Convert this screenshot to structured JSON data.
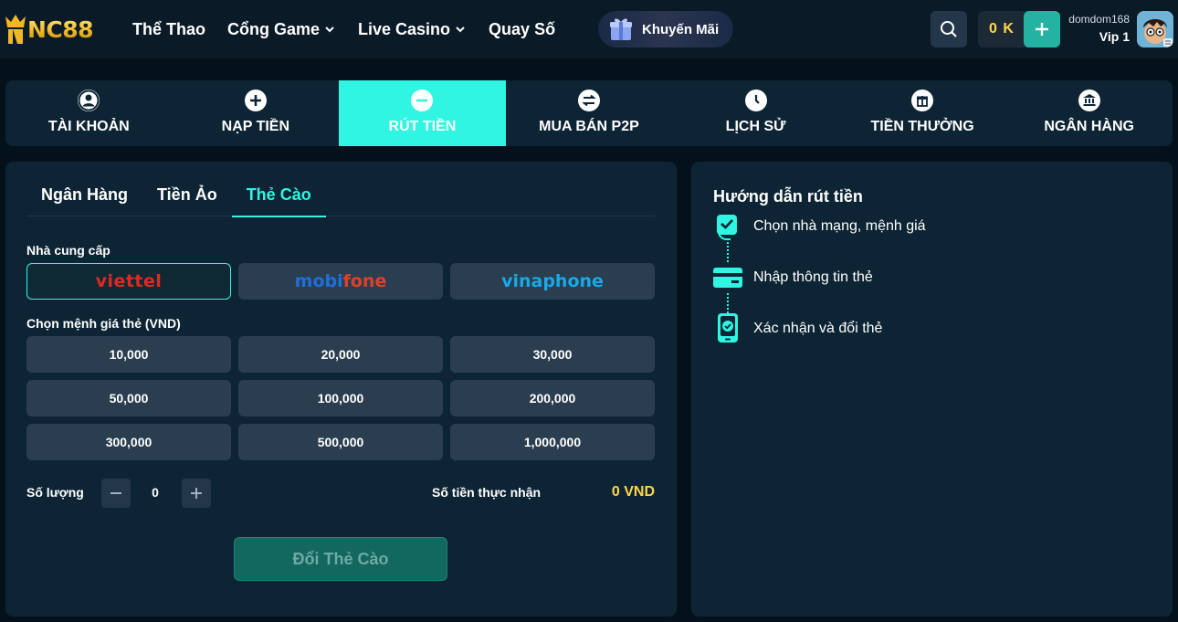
{
  "header": {
    "logo_text": "NC88",
    "nav": [
      {
        "label": "Thể Thao"
      },
      {
        "label": "Cổng Game"
      },
      {
        "label": "Live Casino"
      },
      {
        "label": "Quay Số"
      }
    ],
    "promo_label": "Khuyến Mãi",
    "balance": "0 K",
    "username": "domdom168",
    "vip_level": "Vip 1"
  },
  "tabs": [
    {
      "label": "TÀI KHOẢN",
      "icon": "user-icon"
    },
    {
      "label": "NẠP TIỀN",
      "icon": "plus-circle-icon"
    },
    {
      "label": "RÚT TIỀN",
      "icon": "minus-circle-icon",
      "active": true
    },
    {
      "label": "MUA BÁN P2P",
      "icon": "exchange-icon"
    },
    {
      "label": "LỊCH SỬ",
      "icon": "clock-icon"
    },
    {
      "label": "TIỀN THƯỞNG",
      "icon": "gift-icon"
    },
    {
      "label": "NGÂN HÀNG",
      "icon": "bank-icon"
    }
  ],
  "withdraw": {
    "methods": [
      {
        "label": "Ngân Hàng"
      },
      {
        "label": "Tiền Ảo"
      },
      {
        "label": "Thẻ Cào",
        "active": true
      }
    ],
    "provider_label": "Nhà cung cấp",
    "providers": [
      "viettel",
      "mobifone",
      "vinaphone"
    ],
    "selected_provider": "viettel",
    "denomination_label": "Chọn mệnh giá thẻ (VND)",
    "denominations": [
      "10,000",
      "20,000",
      "30,000",
      "50,000",
      "100,000",
      "200,000",
      "300,000",
      "500,000",
      "1,000,000"
    ],
    "quantity_label": "Số lượng",
    "quantity": "0",
    "received_label": "Số tiền thực nhận",
    "received_value": "0 VND",
    "submit_label": "Đổi Thẻ Cào"
  },
  "guide": {
    "title": "Hướng dẫn rút tiền",
    "steps": [
      {
        "text": "Chọn nhà mạng, mệnh giá",
        "icon": "card-check-icon"
      },
      {
        "text": "Nhập thông tin thẻ",
        "icon": "card-icon"
      },
      {
        "text": "Xác nhận và đổi thẻ",
        "icon": "phone-check-icon"
      }
    ]
  },
  "colors": {
    "accent": "#2ff5e2",
    "gold": "#ffd64a",
    "panel": "#0d2434",
    "background": "#04101a"
  }
}
